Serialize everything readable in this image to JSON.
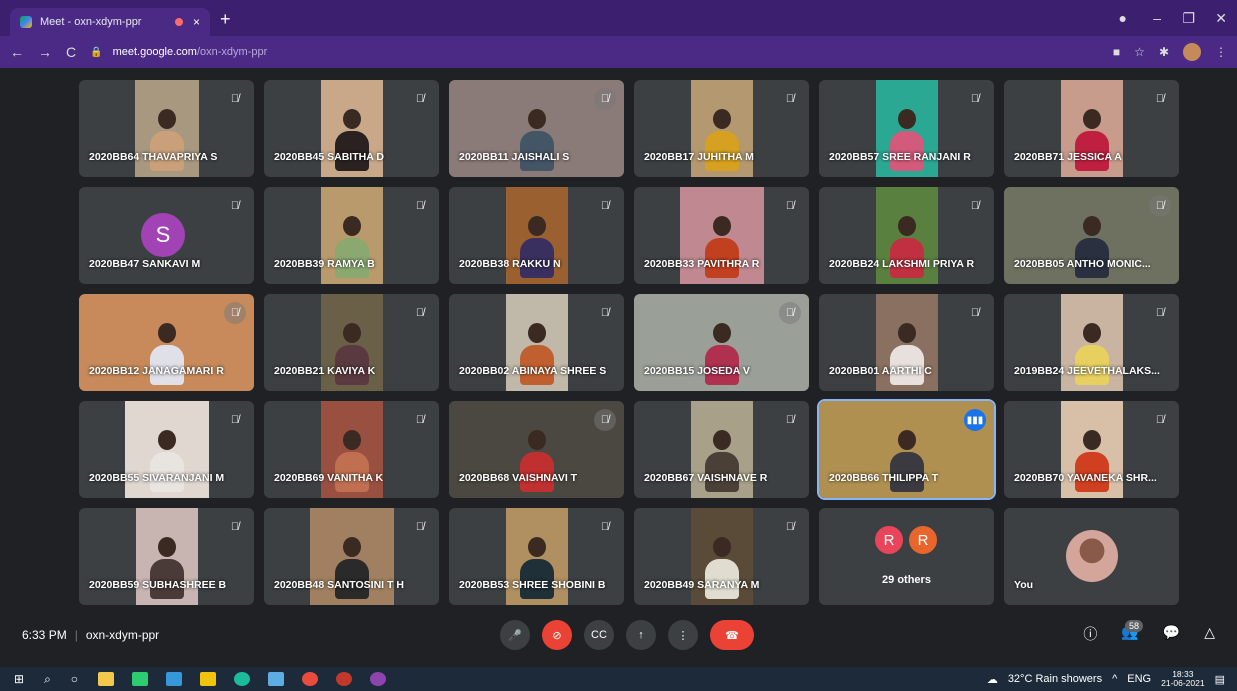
{
  "browser": {
    "tab_title": "Meet - oxn-xdym-ppr",
    "tab_close": "×",
    "new_tab": "+",
    "url_host": "meet.google.com",
    "url_path": "/oxn-xdym-ppr"
  },
  "tiles": [
    {
      "name": "2020BB64 THAVAPRIYA S",
      "bg": "#a89880",
      "cloth": "#c9a07a",
      "w": 64
    },
    {
      "name": "2020BB45 SABITHA D",
      "bg": "#c8a888",
      "cloth": "#2a2220",
      "w": 62
    },
    {
      "name": "2020BB11 JAISHALI S",
      "bg": "#8a7a78",
      "cloth": "#445566",
      "w": 175
    },
    {
      "name": "2020BB17 JUHITHA M",
      "bg": "#b49870",
      "cloth": "#d6a020",
      "w": 62
    },
    {
      "name": "2020BB57 SREE RANJANI R",
      "bg": "#2aa894",
      "cloth": "#d25a7a",
      "w": 62
    },
    {
      "name": "2020BB71 JESSICA A",
      "bg": "#c89c8c",
      "cloth": "#c02040",
      "w": 62
    },
    {
      "name": "2020BB47 SANKAVI M",
      "letter": "S"
    },
    {
      "name": "2020BB39 RAMYA B",
      "bg": "#b89a6c",
      "cloth": "#8aa870",
      "w": 62
    },
    {
      "name": "2020BB38 RAKKU N",
      "bg": "#9a6030",
      "cloth": "#3a3060",
      "w": 62
    },
    {
      "name": "2020BB33 PAVITHRA R",
      "bg": "#c08890",
      "cloth": "#c04020",
      "w": 84
    },
    {
      "name": "2020BB24 LAKSHMI PRIYA R",
      "bg": "#5a8040",
      "cloth": "#c03040",
      "w": 62
    },
    {
      "name": "2020BB05 ANTHO MONIC...",
      "bg": "#6e7060",
      "cloth": "#2a3040",
      "w": 175
    },
    {
      "name": "2020BB12 JANAGAMARI R",
      "bg": "#c88a5a",
      "cloth": "#e0e0e8",
      "w": 175
    },
    {
      "name": "2020BB21 KAVIYA K",
      "bg": "#6a6048",
      "cloth": "#5a3a40",
      "w": 62
    },
    {
      "name": "2020BB02 ABINAYA SHREE S",
      "bg": "#c0b8a8",
      "cloth": "#c06030",
      "w": 62
    },
    {
      "name": "2020BB15 JOSEDA V",
      "bg": "#9aa098",
      "cloth": "#b03050",
      "w": 175
    },
    {
      "name": "2020BB01 AARTHI C",
      "bg": "#8a7060",
      "cloth": "#e8e0dc",
      "w": 62
    },
    {
      "name": "2019BB24 JEEVETHALAKS...",
      "bg": "#c8b4a0",
      "cloth": "#e8d060",
      "w": 62
    },
    {
      "name": "2020BB55 SIVARANJANI M",
      "bg": "#e0d8d0",
      "cloth": "#e8e4e0",
      "w": 84
    },
    {
      "name": "2020BB69 VANITHA K",
      "bg": "#9a5040",
      "cloth": "#c07050",
      "w": 62
    },
    {
      "name": "2020BB68 VAISHNAVI T",
      "bg": "#4a4840",
      "cloth": "#c03030",
      "w": 175
    },
    {
      "name": "2020BB67 VAISHNAVE R",
      "bg": "#a8a088",
      "cloth": "#4a4038",
      "w": 62
    },
    {
      "name": "2020BB66 THILIPPA T",
      "bg": "#b09050",
      "cloth": "#3a3a40",
      "w": 175,
      "speaking": true
    },
    {
      "name": "2020BB70 YAVANEKA SHR...",
      "bg": "#d8c0a8",
      "cloth": "#d04020",
      "w": 62
    },
    {
      "name": "2020BB59 SUBHASHREE B",
      "bg": "#c8b4b0",
      "cloth": "#4a3a38",
      "w": 62
    },
    {
      "name": "2020BB48 SANTOSINI T H",
      "bg": "#a08060",
      "cloth": "#2a2a2a",
      "w": 84
    },
    {
      "name": "2020BB53 SHREE SHOBINI B",
      "bg": "#b09060",
      "cloth": "#203038",
      "w": 62
    },
    {
      "name": "2020BB49 SARANYA M",
      "bg": "#5a4a38",
      "cloth": "#e0dcd0",
      "w": 62
    },
    {
      "others": true,
      "avatars": [
        "R",
        "R"
      ],
      "label": "29 others"
    },
    {
      "you": true,
      "label": "You"
    }
  ],
  "meetbar": {
    "time": "6:33 PM",
    "meeting_code": "oxn-xdym-ppr",
    "participant_count": "58"
  },
  "taskbar": {
    "weather": "32°C Rain showers",
    "lang": "ENG",
    "time": "18:33",
    "date": "21-06-2021"
  },
  "colors": {
    "chrome_bg": "#3c1f6e",
    "meet_bg": "#202124",
    "tile_bg": "#3c4043",
    "hangup": "#ea4335",
    "speaking": "#1a73e8"
  }
}
